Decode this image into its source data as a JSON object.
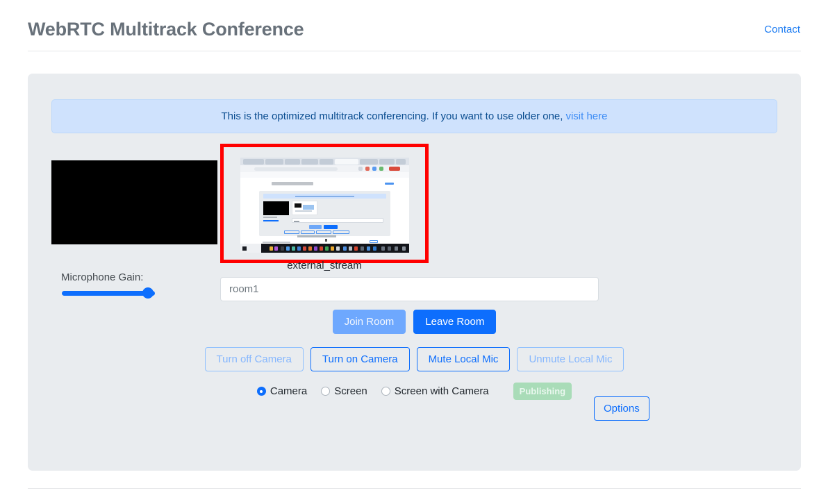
{
  "header": {
    "title": "WebRTC Multitrack Conference",
    "contact_label": "Contact"
  },
  "alert": {
    "text": "This is the optimized multitrack conferencing. If you want to use older one,",
    "link_label": "visit here"
  },
  "local": {
    "gain_label": "Microphone Gain:",
    "gain_value": "87"
  },
  "stream": {
    "caption": "external_stream"
  },
  "room": {
    "value": "room1",
    "placeholder": "room1"
  },
  "actions": {
    "join_label": "Join Room",
    "leave_label": "Leave Room",
    "turn_off_camera_label": "Turn off Camera",
    "turn_on_camera_label": "Turn on Camera",
    "mute_mic_label": "Mute Local Mic",
    "unmute_mic_label": "Unmute Local Mic",
    "options_label": "Options"
  },
  "source": {
    "options": [
      {
        "label": "Camera",
        "checked": true
      },
      {
        "label": "Screen",
        "checked": false
      },
      {
        "label": "Screen with Camera",
        "checked": false
      }
    ],
    "status_badge": "Publishing"
  },
  "colors": {
    "primary": "#0d6efd",
    "card_bg": "#e9ecef",
    "alert_bg": "#cfe2fd",
    "highlight_border": "#ff0000",
    "badge_bg": "#a9dcb8",
    "title": "#68717a"
  }
}
